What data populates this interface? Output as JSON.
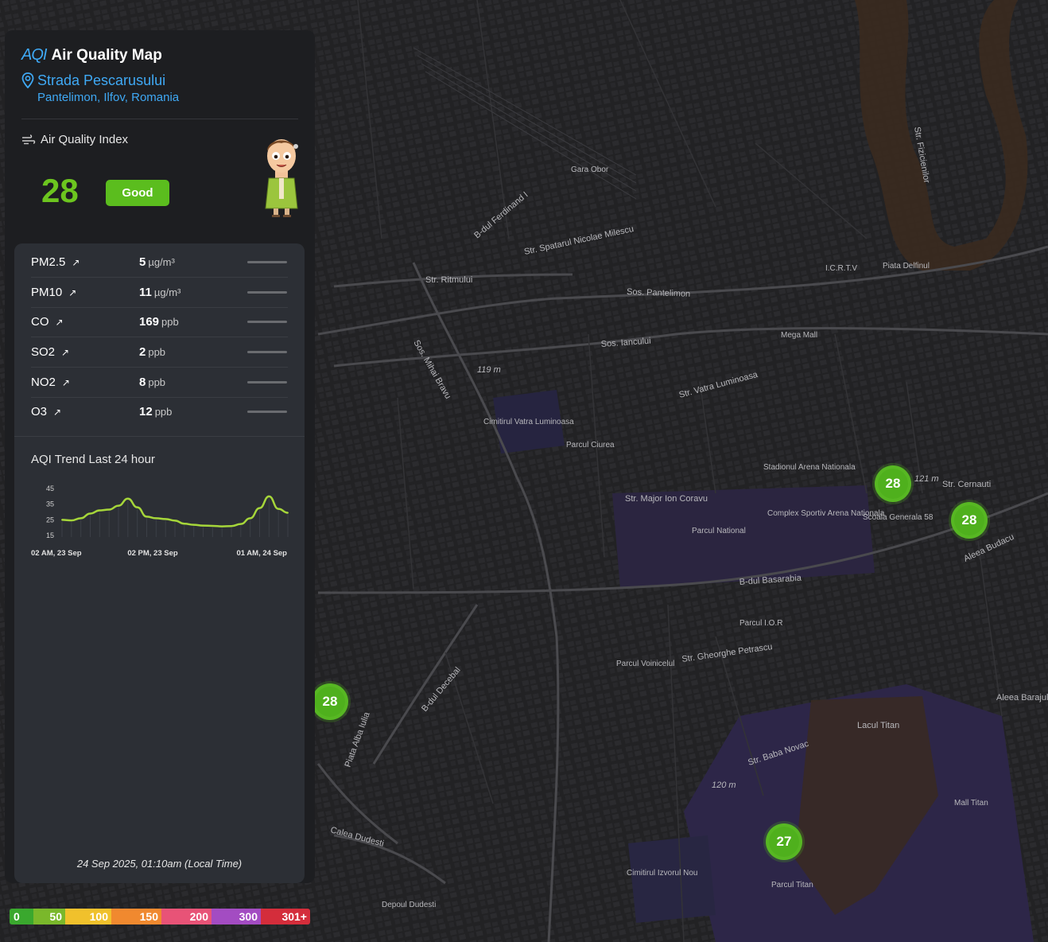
{
  "app": {
    "logo_text": "AQI",
    "title": "Air Quality Map"
  },
  "location": {
    "street": "Strada Pescarusului",
    "area": "Pantelimon, Ilfov, Romania"
  },
  "aqi": {
    "heading": "Air Quality Index",
    "value": "28",
    "status": "Good",
    "status_color": "#5bbd1e",
    "value_color": "#6cc51f"
  },
  "pollutants": [
    {
      "name": "PM2.5",
      "value": "5",
      "unit": "µg/m³"
    },
    {
      "name": "PM10",
      "value": "11",
      "unit": "µg/m³"
    },
    {
      "name": "CO",
      "value": "169",
      "unit": "ppb"
    },
    {
      "name": "SO2",
      "value": "2",
      "unit": "ppb"
    },
    {
      "name": "NO2",
      "value": "8",
      "unit": "ppb"
    },
    {
      "name": "O3",
      "value": "12",
      "unit": "ppb"
    }
  ],
  "trend": {
    "title": "AQI Trend Last 24 hour",
    "timestamp": "24 Sep 2025, 01:10am (Local Time)"
  },
  "chart_data": {
    "type": "line",
    "title": "AQI Trend Last 24 hour",
    "xlabel": "",
    "ylabel": "",
    "yticks": [
      45,
      35,
      25,
      15
    ],
    "ylim": [
      15,
      45
    ],
    "xtick_labels": [
      "02 AM, 23 Sep",
      "02 PM, 23 Sep",
      "01 AM, 24 Sep"
    ],
    "xtick_index": [
      0,
      12,
      23
    ],
    "values": [
      25,
      24.6,
      26,
      29,
      31,
      31.5,
      34,
      38.5,
      33,
      27,
      26,
      25.5,
      24.5,
      22.5,
      21.8,
      21.3,
      21.1,
      20.8,
      21,
      22.3,
      26,
      32.5,
      40,
      32,
      29.5
    ],
    "line_color": "#a6d63a",
    "grid": false
  },
  "legend": [
    {
      "label": "0",
      "color": "#3aa82e"
    },
    {
      "label": "50",
      "color": "#7ab82b"
    },
    {
      "label": "100",
      "color": "#f0c12c"
    },
    {
      "label": "150",
      "color": "#f0892f"
    },
    {
      "label": "200",
      "color": "#e85377"
    },
    {
      "label": "300",
      "color": "#a34cc2"
    },
    {
      "label": "301+",
      "color": "#d42d3b"
    }
  ],
  "markers": [
    {
      "value": "28"
    },
    {
      "value": "28"
    },
    {
      "value": "28"
    },
    {
      "value": "27"
    }
  ],
  "map_labels": [
    {
      "text": "Sos. Pantelimon"
    },
    {
      "text": "Sos. Iancului"
    },
    {
      "text": "B-dul Basarabia"
    },
    {
      "text": "Str. Ritmului"
    },
    {
      "text": "Lacul Titan"
    },
    {
      "text": "Stadionul Arena Nationala"
    },
    {
      "text": "Parcul National"
    },
    {
      "text": "Parcul Titan"
    },
    {
      "text": "Complex Sportiv Arena Nationala"
    },
    {
      "text": "Mega Mall"
    },
    {
      "text": "I.C.R.T.V"
    },
    {
      "text": "Cimitirul Vatra Luminoasa"
    },
    {
      "text": "Piata Delfinul"
    },
    {
      "text": "Scoala Generala 58"
    },
    {
      "text": "Str. Vatra Luminoasa"
    },
    {
      "text": "Sos. Mihai Bravu"
    },
    {
      "text": "Cimitirul Izvorul Nou"
    },
    {
      "text": "Depoul Dudesti"
    },
    {
      "text": "Calea Dudesti"
    },
    {
      "text": "B-dul Decebal"
    },
    {
      "text": "Str. Major Ion Coravu"
    },
    {
      "text": "Str. Gheorghe Petrascu"
    },
    {
      "text": "Str. Baba Novac"
    },
    {
      "text": "Mall Titan"
    },
    {
      "text": "Piata Alba Iulia"
    },
    {
      "text": "Gara Obor"
    },
    {
      "text": "Str. Spatarul Nicolae Milescu"
    },
    {
      "text": "B-dul Ferdinand I"
    },
    {
      "text": "Parcul Ciurea"
    },
    {
      "text": "Str. Cernauti"
    },
    {
      "text": "Aleea Budacu"
    },
    {
      "text": "Aleea Barajul"
    },
    {
      "text": "Parcul Voinicelul"
    },
    {
      "text": "Parcul I.O.R"
    },
    {
      "text": "Str. Fizicienilor"
    },
    {
      "text": "119 m"
    },
    {
      "text": "120 m"
    },
    {
      "text": "121 m"
    }
  ]
}
